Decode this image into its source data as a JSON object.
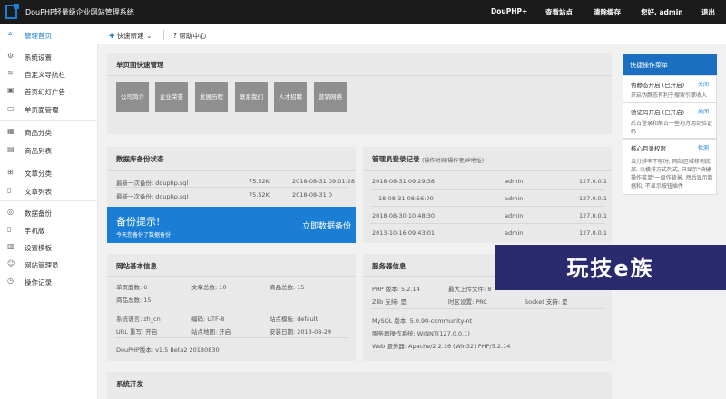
{
  "header": {
    "brand": "DouPHP轻量级企业网站管理系统",
    "nav": [
      "DouPHP+",
      "查看站点",
      "清除缓存",
      "您好, admin",
      "退出"
    ]
  },
  "subbar": {
    "home": "管理首页",
    "quick_new": "快速新建",
    "help": "帮助中心"
  },
  "sidebar": {
    "items": [
      {
        "label": "系统设置",
        "icon": "gear-icon"
      },
      {
        "label": "自定义导航栏",
        "icon": "nav-icon"
      },
      {
        "label": "首页幻灯广告",
        "icon": "slides-icon"
      },
      {
        "label": "单页面管理",
        "icon": "page-icon"
      },
      {
        "label": "商品分类",
        "icon": "category-icon"
      },
      {
        "label": "商品列表",
        "icon": "list-icon"
      },
      {
        "label": "文章分类",
        "icon": "category-icon"
      },
      {
        "label": "文章列表",
        "icon": "article-icon"
      },
      {
        "label": "数据备份",
        "icon": "database-icon"
      },
      {
        "label": "手机版",
        "icon": "mobile-icon"
      },
      {
        "label": "设置模板",
        "icon": "template-icon"
      },
      {
        "label": "网站管理员",
        "icon": "admin-icon"
      },
      {
        "label": "操作记录",
        "icon": "log-icon"
      }
    ]
  },
  "single_page": {
    "title": "单页面快速管理",
    "buttons": [
      "公司简介",
      "企业荣誉",
      "发展历程",
      "联系我们",
      "人才招聘",
      "营销网络"
    ]
  },
  "db_status": {
    "title": "数据库备份状态",
    "rows": [
      {
        "label": "最新一次备份: douphp.sql",
        "size": "75.52K",
        "time": "2018-08-31 09:01:28"
      },
      {
        "label": "最新一次备份: douphp.sql",
        "size": "75.52K",
        "time": "2018-08-31 0"
      }
    ],
    "alert_title": "备份提示!",
    "alert_sub": "今天您备份了数据备份",
    "alert_action": "立即数据备份"
  },
  "login_log": {
    "title": "管理员登录记录",
    "subtitle": "(操作时间/操作者/IP地址)",
    "rows": [
      {
        "time": "2018-08-31 09:29:38",
        "user": "admin",
        "ip": "127.0.0.1"
      },
      {
        "time": "18-08-31 08:56:00",
        "user": "admin",
        "ip": "127.0.0.1"
      },
      {
        "time": "2018-08-30 10:48:30",
        "user": "admin",
        "ip": "127.0.0.1"
      },
      {
        "time": "2013-10-16 09:43:01",
        "user": "admin",
        "ip": "127.0.0.1"
      }
    ]
  },
  "site_info": {
    "title": "网站基本信息",
    "single_pages": "单页面数: 6",
    "articles": "文章总数: 10",
    "products_total": "商品总数: 15",
    "products": "商品总数: 15",
    "lang": "系统语言: zh_cn",
    "charset": "编码: UTF-8",
    "template": "站点模板: default",
    "rewrite": "URL 重写: 开启",
    "sitemap": "站点地图: 开启",
    "install_date": "安装日期: 2013-08-29",
    "version": "DouPHP版本: v1.5 Beta2 20180830"
  },
  "server_info": {
    "title": "服务器信息",
    "php": "PHP 版本: 5.2.14",
    "upload": "最大上传文件: 8",
    "zlib": "Zlib 支持: 是",
    "timezone": "时区设置: PRC",
    "socket": "Socket 支持: 是",
    "mysql": "MySQL 版本: 5.0.90-community-nt",
    "os": "服务器操作系统: WINNT(127.0.0.1)",
    "web": "Web 服务器: Apache/2.2.16 (Win32) PHP/5.2.14"
  },
  "system_dev": {
    "title": "系统开发"
  },
  "right_panel": {
    "header": "快捷操作菜单",
    "blocks": [
      {
        "title": "伪静态开启 (已开启)",
        "link": "关闭",
        "desc": "开启伪静态有利于搜索引擎收入"
      },
      {
        "title": "验证码开启 (已开启)",
        "link": "关闭",
        "desc": "后台登录和前台一些地方用到验证码"
      },
      {
        "title": "核心目录权限",
        "link": "检测",
        "desc": "当分辨率不够时, 网站区域移到底部, 以横排方式列式, 只显示\"快捷操作菜单\"一级作背景, 然后显示数据和, 不显示按钮插件"
      }
    ]
  },
  "watermark": "玩技e族",
  "colors": {
    "accent": "#1a7fd4",
    "topbar": "#1b1b1b"
  }
}
